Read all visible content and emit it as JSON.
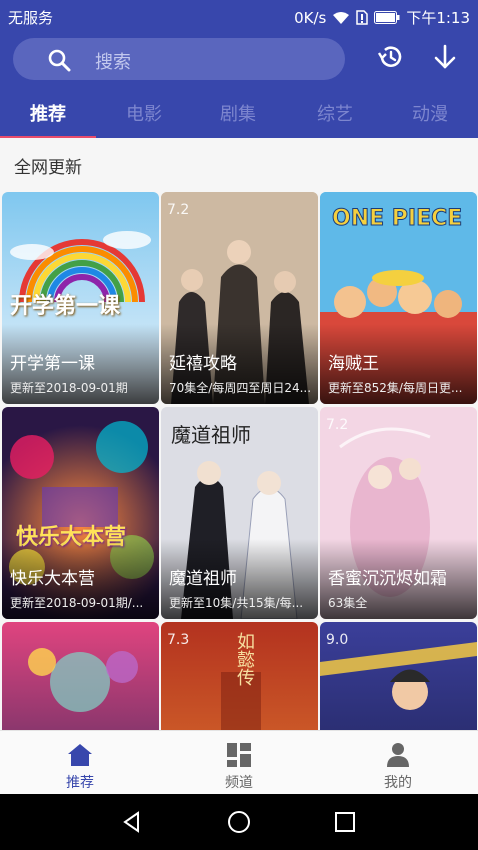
{
  "status_bar": {
    "carrier": "无服务",
    "speed": "0K/s",
    "time": "下午1:13"
  },
  "search": {
    "placeholder": "搜索"
  },
  "tabs": [
    {
      "label": "推荐",
      "active": true
    },
    {
      "label": "电影",
      "active": false
    },
    {
      "label": "剧集",
      "active": false
    },
    {
      "label": "综艺",
      "active": false
    },
    {
      "label": "动漫",
      "active": false
    }
  ],
  "section_title": "全网更新",
  "cards": [
    {
      "title": "开学第一课",
      "subtitle": "更新至2018-09-01期",
      "rating": "",
      "art_text": "开学第一课"
    },
    {
      "title": "延禧攻略",
      "subtitle": "70集全/每周四至周日24...",
      "rating": "7.2",
      "art_text": ""
    },
    {
      "title": "海贼王",
      "subtitle": "更新至852集/每周日更...",
      "rating": "",
      "art_text": "ONE PIECE"
    },
    {
      "title": "快乐大本营",
      "subtitle": "更新至2018-09-01期/...",
      "rating": "",
      "art_text": "快乐大本营"
    },
    {
      "title": "魔道祖师",
      "subtitle": "更新至10集/共15集/每...",
      "rating": "",
      "art_text": "魔道祖师"
    },
    {
      "title": "香蜜沉沉烬如霜",
      "subtitle": "63集全",
      "rating": "7.2",
      "art_text": ""
    },
    {
      "title": "",
      "subtitle": "",
      "rating": "",
      "art_text": ""
    },
    {
      "title": "",
      "subtitle": "",
      "rating": "7.3",
      "art_text": "如懿传"
    },
    {
      "title": "",
      "subtitle": "",
      "rating": "9.0",
      "art_text": ""
    }
  ],
  "bottom_nav": [
    {
      "label": "推荐",
      "icon": "home-icon",
      "active": true
    },
    {
      "label": "频道",
      "icon": "grid-icon",
      "active": false
    },
    {
      "label": "我的",
      "icon": "user-icon",
      "active": false
    }
  ],
  "colors": {
    "primary": "#3847ac",
    "tab_indicator": "#e94c6b"
  }
}
